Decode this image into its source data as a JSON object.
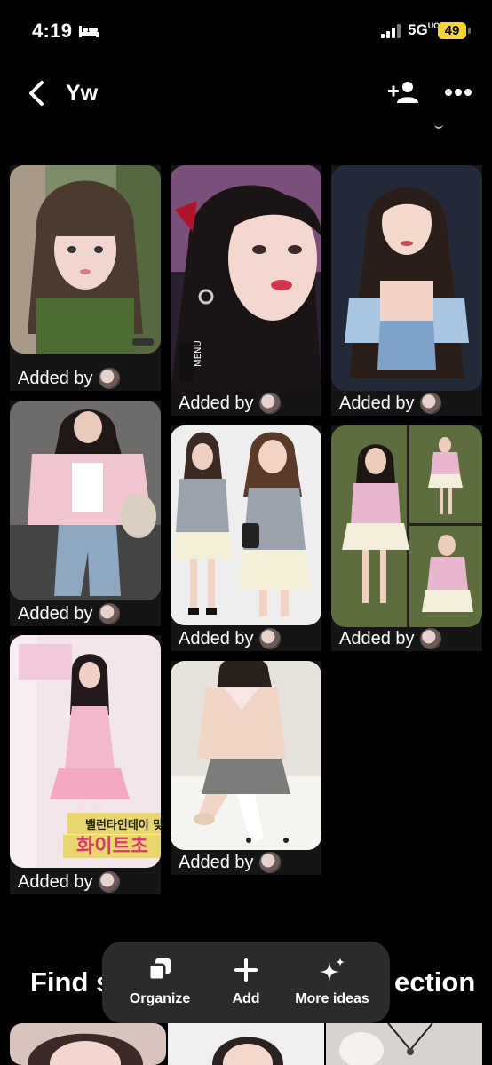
{
  "status": {
    "time": "4:19",
    "network": "5G",
    "network_sub": "UC",
    "battery": "49"
  },
  "header": {
    "title": "Yw"
  },
  "pins": [
    {
      "added_label": "Added by"
    },
    {
      "added_label": "Added by"
    },
    {
      "added_label": "Added by"
    },
    {
      "added_label": "Added by"
    },
    {
      "added_label": "Added by"
    },
    {
      "added_label": "Added by"
    },
    {
      "added_label": "Added by"
    },
    {
      "added_label": "Added by"
    }
  ],
  "pin_overlays": {
    "menu_label": "MENU",
    "korean_top": "밸런타인데이 맞이",
    "korean_big": "화이트초"
  },
  "section": {
    "find_prefix": "Find s",
    "find_suffix": "ection"
  },
  "toolbar": {
    "organize": "Organize",
    "add": "Add",
    "more_ideas": "More ideas"
  },
  "colors": {
    "background": "#000000",
    "toolbar_bg": "#2b2b2b",
    "battery": "#f5d43b"
  }
}
